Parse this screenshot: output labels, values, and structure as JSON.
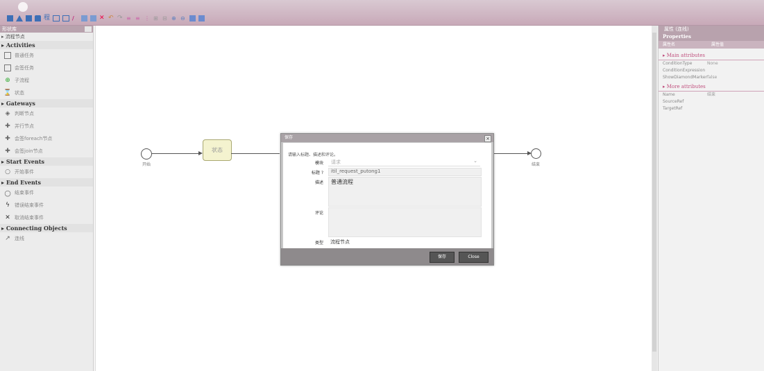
{
  "palette": {
    "title": "形状库",
    "group": "流程节点",
    "sections": [
      {
        "title": "Activities",
        "items": [
          {
            "icon": "task-icon",
            "label": "普通任务"
          },
          {
            "icon": "task-icon",
            "label": "会签任务"
          },
          {
            "icon": "subprocess-icon",
            "label": "子流程"
          },
          {
            "icon": "state-icon",
            "label": "状态"
          }
        ]
      },
      {
        "title": "Gateways",
        "items": [
          {
            "icon": "exclusive-gateway-icon",
            "label": "判断节点"
          },
          {
            "icon": "parallel-gateway-icon",
            "label": "并行节点"
          },
          {
            "icon": "foreach-gateway-icon",
            "label": "会签foreach节点"
          },
          {
            "icon": "join-gateway-icon",
            "label": "会签join节点"
          }
        ]
      },
      {
        "title": "Start Events",
        "items": [
          {
            "icon": "start-event-icon",
            "label": "开始事件"
          }
        ]
      },
      {
        "title": "End Events",
        "items": [
          {
            "icon": "end-event-icon",
            "label": "结束事件"
          },
          {
            "icon": "error-end-icon",
            "label": "错误结束事件"
          },
          {
            "icon": "cancel-end-icon",
            "label": "取消结束事件"
          }
        ]
      },
      {
        "title": "Connecting Objects",
        "items": [
          {
            "icon": "connector-icon",
            "label": "连线"
          }
        ]
      }
    ]
  },
  "diagram": {
    "start_label": "开始",
    "task_label": "状态",
    "end_label": "结束"
  },
  "dialog": {
    "title": "保存",
    "intro": "请输入标题、描述和评论。",
    "module_label": "模块",
    "module_placeholder": "请求",
    "title_label": "标题 ?",
    "title_value": "itil_request_putong1",
    "desc_label": "描述",
    "desc_value": "普通流程",
    "comment_label": "评论",
    "comment_value": "",
    "type_label": "类型",
    "type_value": "流程节点",
    "save_button": "保存",
    "close_button": "Close"
  },
  "properties": {
    "title": "属性 (连线)",
    "subtitle": "Properties",
    "col_name": "属性名",
    "col_value": "属性值",
    "main_group": "Main attributes",
    "main_rows": [
      {
        "name": "ConditionType",
        "value": "None"
      },
      {
        "name": "ConditionExpression",
        "value": ""
      },
      {
        "name": "ShowDiamondMarker",
        "value": "false"
      }
    ],
    "more_group": "More attributes",
    "more_rows": [
      {
        "name": "Name",
        "value": "结束"
      },
      {
        "name": "SourceRef",
        "value": ""
      },
      {
        "name": "TargetRef",
        "value": ""
      }
    ]
  }
}
